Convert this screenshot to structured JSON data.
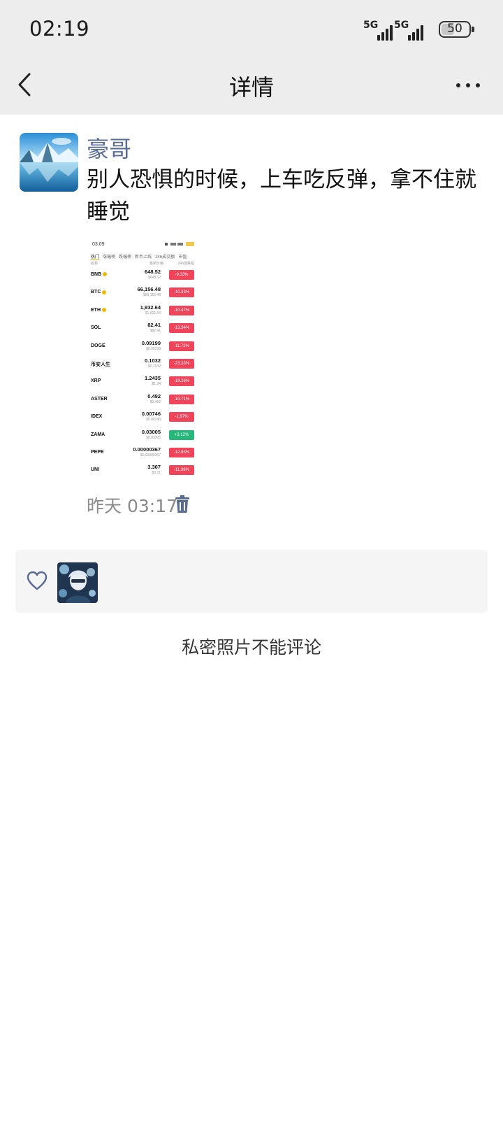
{
  "status_bar": {
    "time": "02:19",
    "network1": "5G",
    "network2": "5G",
    "battery": "50",
    "icons": [
      "signal-5g-icon",
      "signal-5g-icon",
      "battery-icon"
    ]
  },
  "header": {
    "title": "详情",
    "back_icon": "chevron-left-icon",
    "more_icon": "more-dots-icon"
  },
  "post": {
    "author": "豪哥",
    "text": "别人恐惧的时候，上车吃反弹，拿不住就睡觉",
    "time": "昨天 03:17",
    "delete_icon": "trash-icon",
    "image": {
      "time": "03:09",
      "tabs": [
        "热门",
        "涨幅榜",
        "跌幅榜",
        "新币上线",
        "24h成交额",
        "市值"
      ],
      "col_name": "名称",
      "col_price": "最新价格",
      "col_change": "24h涨跌幅",
      "rows": [
        {
          "symbol": "BNB",
          "hot": true,
          "price": "648.52",
          "sub": "$648.52",
          "change": "-9.33%",
          "up": false
        },
        {
          "symbol": "BTC",
          "hot": true,
          "price": "66,156.48",
          "sub": "$66,156.48",
          "change": "-10.33%",
          "up": false
        },
        {
          "symbol": "ETH",
          "hot": true,
          "price": "1,932.64",
          "sub": "$1,932.64",
          "change": "-10.47%",
          "up": false
        },
        {
          "symbol": "SOL",
          "hot": false,
          "price": "82.41",
          "sub": "$82.41",
          "change": "-13.34%",
          "up": false
        },
        {
          "symbol": "DOGE",
          "hot": false,
          "price": "0.09199",
          "sub": "$0.09199",
          "change": "-11.72%",
          "up": false
        },
        {
          "symbol": "币安人生",
          "hot": false,
          "price": "0.1032",
          "sub": "$0.1032",
          "change": "-23.33%",
          "up": false
        },
        {
          "symbol": "XRP",
          "hot": false,
          "price": "1.2435",
          "sub": "$1.24",
          "change": "-19.26%",
          "up": false
        },
        {
          "symbol": "ASTER",
          "hot": false,
          "price": "0.492",
          "sub": "$0.492",
          "change": "-10.71%",
          "up": false
        },
        {
          "symbol": "IDEX",
          "hot": false,
          "price": "0.00746",
          "sub": "$0.00746",
          "change": "-1.97%",
          "up": false
        },
        {
          "symbol": "ZAMA",
          "hot": false,
          "price": "0.03005",
          "sub": "$0.03005",
          "change": "+3.12%",
          "up": true
        },
        {
          "symbol": "PEPE",
          "hot": false,
          "price": "0.00000367",
          "sub": "$0.00000367",
          "change": "-12.83%",
          "up": false
        },
        {
          "symbol": "UNI",
          "hot": false,
          "price": "3.307",
          "sub": "$3.31",
          "change": "-11.98%",
          "up": false
        }
      ]
    }
  },
  "likes": {
    "icon": "heart-outline-icon"
  },
  "comments": {
    "notice": "私密照片不能评论"
  },
  "colors": {
    "name_blue": "#576b95",
    "header_bg": "#ededed",
    "down_red": "#f0445a",
    "up_green": "#26b77a"
  }
}
